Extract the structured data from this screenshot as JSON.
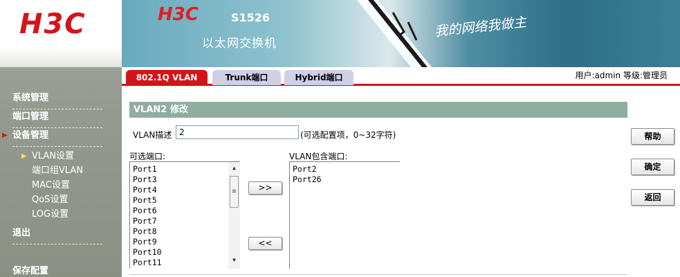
{
  "sidebar": {
    "logo": "H3C",
    "items": [
      {
        "label": "系统管理"
      },
      {
        "label": "端口管理"
      },
      {
        "label": "设备管理"
      },
      {
        "label": "VLAN设置"
      },
      {
        "label": "端口组VLAN"
      },
      {
        "label": "MAC设置"
      },
      {
        "label": "QoS设置"
      },
      {
        "label": "LOG设置"
      },
      {
        "label": "退出"
      },
      {
        "label": "保存配置"
      }
    ]
  },
  "banner": {
    "brand": "H3C",
    "model": "S1526",
    "subtitle": "以太网交换机",
    "slogan": "我的网络我做主"
  },
  "tabs": [
    {
      "label": "802.1Q VLAN",
      "active": true
    },
    {
      "label": "Trunk端口",
      "active": false
    },
    {
      "label": "Hybrid端口",
      "active": false
    }
  ],
  "user": {
    "info": "用户:admin  等级:管理员"
  },
  "form": {
    "section_title": "VLAN2 修改",
    "desc_label": "VLAN描述",
    "desc_value": "2",
    "desc_hint": "(可选配置项，0~32字符)",
    "available_label": "可选端口:",
    "member_label": "VLAN包含端口:",
    "available_ports": [
      "Port1",
      "Port3",
      "Port4",
      "Port5",
      "Port6",
      "Port7",
      "Port8",
      "Port9",
      "Port10",
      "Port11"
    ],
    "member_ports": [
      "Port2",
      "Port26"
    ],
    "move_right_label": ">>",
    "move_left_label": "<<"
  },
  "actions": {
    "help": "帮助",
    "ok": "确定",
    "back": "返回"
  },
  "colors": {
    "brand_red": "#d4141b",
    "section_header": "#8faea0",
    "inactive_tab": "#cfcfe8",
    "sidebar": "#959a90"
  }
}
